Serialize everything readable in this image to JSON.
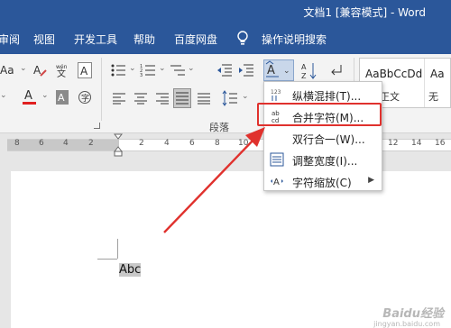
{
  "window": {
    "title": "文档1 [兼容模式] - Word"
  },
  "menu": {
    "tabs": [
      "审阅",
      "视图",
      "开发工具",
      "帮助",
      "百度网盘"
    ],
    "tell_me": "操作说明搜索"
  },
  "ribbon": {
    "font_size_icon": "Aa",
    "font_color_letter": "A",
    "font_color_accent": "#e02020",
    "paragraph_group_label": "段落",
    "styles": [
      {
        "sample": "AaBbCcDd",
        "name": "正文"
      },
      {
        "sample": "Aa",
        "name": "无"
      }
    ]
  },
  "ruler": {
    "numbers": [
      "8",
      "6",
      "4",
      "2",
      "2",
      "4",
      "6",
      "8",
      "10",
      "12",
      "14",
      "16"
    ]
  },
  "document": {
    "text": "Abc"
  },
  "dropdown": {
    "items": [
      {
        "icon": "vertical-horizontal-icon",
        "label": "纵横混排(T)...",
        "has_submenu": false
      },
      {
        "icon": "combine-characters-icon",
        "label": "合并字符(M)...",
        "has_submenu": false,
        "highlighted": true
      },
      {
        "icon": "two-lines-in-one-icon",
        "label": "双行合一(W)...",
        "has_submenu": false
      },
      {
        "icon": "fit-text-icon",
        "label": "调整宽度(I)...",
        "has_submenu": false
      },
      {
        "icon": "character-scaling-icon",
        "label": "字符缩放(C)",
        "has_submenu": true
      }
    ]
  },
  "colors": {
    "accent": "#2b579a",
    "annotation": "#e0312d"
  },
  "watermark": {
    "text": "Baidu经验",
    "url": "jingyan.baidu.com"
  }
}
